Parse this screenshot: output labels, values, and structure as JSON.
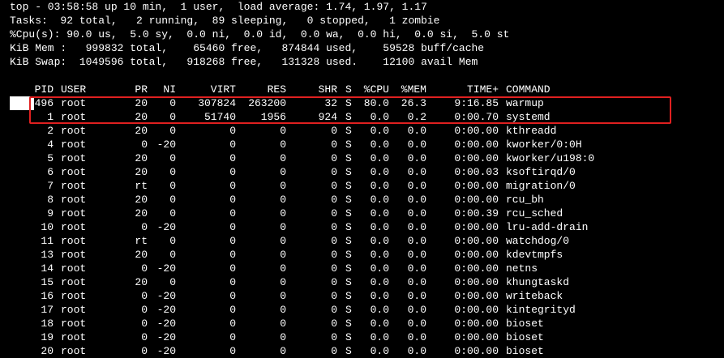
{
  "summary": {
    "uptime_line": "top - 03:58:58 up 10 min,  1 user,  load average: 1.74, 1.97, 1.17",
    "tasks_line": "Tasks:  92 total,   2 running,  89 sleeping,   0 stopped,   1 zombie",
    "cpu_line": "%Cpu(s): 90.0 us,  5.0 sy,  0.0 ni,  0.0 id,  0.0 wa,  0.0 hi,  0.0 si,  5.0 st",
    "mem_line": "KiB Mem :   999832 total,    65460 free,   874844 used,    59528 buff/cache",
    "swap_line": "KiB Swap:  1049596 total,   918268 free,   131328 used.    12100 avail Mem"
  },
  "columns": {
    "pid": "PID",
    "user": "USER",
    "pr": "PR",
    "ni": "NI",
    "virt": "VIRT",
    "res": "RES",
    "shr": "SHR",
    "s": "S",
    "cpu": "%CPU",
    "mem": "%MEM",
    "time": "TIME+",
    "command": "COMMAND"
  },
  "processes": [
    {
      "pid": "496",
      "user": "root",
      "pr": "20",
      "ni": "0",
      "virt": "307824",
      "res": "263200",
      "shr": "32",
      "s": "S",
      "cpu": "80.0",
      "mem": "26.3",
      "time": "9:16.85",
      "command": "warmup"
    },
    {
      "pid": "1",
      "user": "root",
      "pr": "20",
      "ni": "0",
      "virt": "51740",
      "res": "1956",
      "shr": "924",
      "s": "S",
      "cpu": "0.0",
      "mem": "0.2",
      "time": "0:00.70",
      "command": "systemd"
    },
    {
      "pid": "2",
      "user": "root",
      "pr": "20",
      "ni": "0",
      "virt": "0",
      "res": "0",
      "shr": "0",
      "s": "S",
      "cpu": "0.0",
      "mem": "0.0",
      "time": "0:00.00",
      "command": "kthreadd"
    },
    {
      "pid": "4",
      "user": "root",
      "pr": "0",
      "ni": "-20",
      "virt": "0",
      "res": "0",
      "shr": "0",
      "s": "S",
      "cpu": "0.0",
      "mem": "0.0",
      "time": "0:00.00",
      "command": "kworker/0:0H"
    },
    {
      "pid": "5",
      "user": "root",
      "pr": "20",
      "ni": "0",
      "virt": "0",
      "res": "0",
      "shr": "0",
      "s": "S",
      "cpu": "0.0",
      "mem": "0.0",
      "time": "0:00.00",
      "command": "kworker/u198:0"
    },
    {
      "pid": "6",
      "user": "root",
      "pr": "20",
      "ni": "0",
      "virt": "0",
      "res": "0",
      "shr": "0",
      "s": "S",
      "cpu": "0.0",
      "mem": "0.0",
      "time": "0:00.03",
      "command": "ksoftirqd/0"
    },
    {
      "pid": "7",
      "user": "root",
      "pr": "rt",
      "ni": "0",
      "virt": "0",
      "res": "0",
      "shr": "0",
      "s": "S",
      "cpu": "0.0",
      "mem": "0.0",
      "time": "0:00.00",
      "command": "migration/0"
    },
    {
      "pid": "8",
      "user": "root",
      "pr": "20",
      "ni": "0",
      "virt": "0",
      "res": "0",
      "shr": "0",
      "s": "S",
      "cpu": "0.0",
      "mem": "0.0",
      "time": "0:00.00",
      "command": "rcu_bh"
    },
    {
      "pid": "9",
      "user": "root",
      "pr": "20",
      "ni": "0",
      "virt": "0",
      "res": "0",
      "shr": "0",
      "s": "S",
      "cpu": "0.0",
      "mem": "0.0",
      "time": "0:00.39",
      "command": "rcu_sched"
    },
    {
      "pid": "10",
      "user": "root",
      "pr": "0",
      "ni": "-20",
      "virt": "0",
      "res": "0",
      "shr": "0",
      "s": "S",
      "cpu": "0.0",
      "mem": "0.0",
      "time": "0:00.00",
      "command": "lru-add-drain"
    },
    {
      "pid": "11",
      "user": "root",
      "pr": "rt",
      "ni": "0",
      "virt": "0",
      "res": "0",
      "shr": "0",
      "s": "S",
      "cpu": "0.0",
      "mem": "0.0",
      "time": "0:00.00",
      "command": "watchdog/0"
    },
    {
      "pid": "13",
      "user": "root",
      "pr": "20",
      "ni": "0",
      "virt": "0",
      "res": "0",
      "shr": "0",
      "s": "S",
      "cpu": "0.0",
      "mem": "0.0",
      "time": "0:00.00",
      "command": "kdevtmpfs"
    },
    {
      "pid": "14",
      "user": "root",
      "pr": "0",
      "ni": "-20",
      "virt": "0",
      "res": "0",
      "shr": "0",
      "s": "S",
      "cpu": "0.0",
      "mem": "0.0",
      "time": "0:00.00",
      "command": "netns"
    },
    {
      "pid": "15",
      "user": "root",
      "pr": "20",
      "ni": "0",
      "virt": "0",
      "res": "0",
      "shr": "0",
      "s": "S",
      "cpu": "0.0",
      "mem": "0.0",
      "time": "0:00.00",
      "command": "khungtaskd"
    },
    {
      "pid": "16",
      "user": "root",
      "pr": "0",
      "ni": "-20",
      "virt": "0",
      "res": "0",
      "shr": "0",
      "s": "S",
      "cpu": "0.0",
      "mem": "0.0",
      "time": "0:00.00",
      "command": "writeback"
    },
    {
      "pid": "17",
      "user": "root",
      "pr": "0",
      "ni": "-20",
      "virt": "0",
      "res": "0",
      "shr": "0",
      "s": "S",
      "cpu": "0.0",
      "mem": "0.0",
      "time": "0:00.00",
      "command": "kintegrityd"
    },
    {
      "pid": "18",
      "user": "root",
      "pr": "0",
      "ni": "-20",
      "virt": "0",
      "res": "0",
      "shr": "0",
      "s": "S",
      "cpu": "0.0",
      "mem": "0.0",
      "time": "0:00.00",
      "command": "bioset"
    },
    {
      "pid": "19",
      "user": "root",
      "pr": "0",
      "ni": "-20",
      "virt": "0",
      "res": "0",
      "shr": "0",
      "s": "S",
      "cpu": "0.0",
      "mem": "0.0",
      "time": "0:00.00",
      "command": "bioset"
    },
    {
      "pid": "20",
      "user": "root",
      "pr": "0",
      "ni": "-20",
      "virt": "0",
      "res": "0",
      "shr": "0",
      "s": "S",
      "cpu": "0.0",
      "mem": "0.0",
      "time": "0:00.00",
      "command": "bioset"
    }
  ],
  "colors": {
    "background": "#000000",
    "text": "#ffffff",
    "highlight_box": "#e02020"
  }
}
